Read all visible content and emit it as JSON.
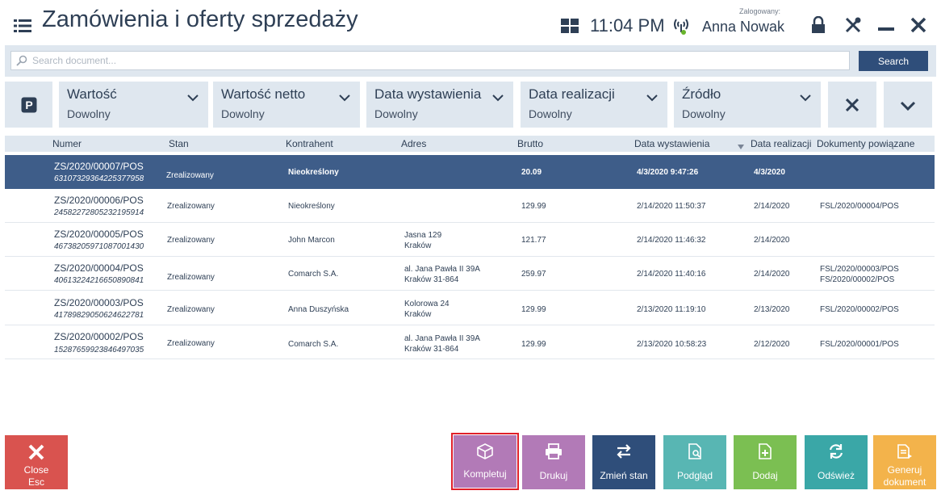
{
  "header": {
    "title": "Zamówienia i oferty sprzedaży",
    "time": "11:04 PM",
    "logged_label": "Zalogowany:",
    "user": "Anna Nowak"
  },
  "search": {
    "placeholder": "Search document...",
    "button": "Search"
  },
  "filters": [
    {
      "label": "Wartość",
      "value": "Dowolny"
    },
    {
      "label": "Wartość netto",
      "value": "Dowolny"
    },
    {
      "label": "Data wystawienia",
      "value": "Dowolny"
    },
    {
      "label": "Data realizacji",
      "value": "Dowolny"
    },
    {
      "label": "Źródło",
      "value": "Dowolny"
    }
  ],
  "table": {
    "columns": [
      "Numer",
      "Stan",
      "Kontrahent",
      "Adres",
      "Brutto",
      "Data wystawienia",
      "Data realizacji",
      "Dokumenty powiązane"
    ],
    "rows": [
      {
        "numer": "ZS/2020/00007/POS",
        "code": "63107329364225377958",
        "stan": "Zrealizowany",
        "kontrahent": "Nieokreślony",
        "adres1": "",
        "adres2": "",
        "brutto": "20.09",
        "data_wyst": "4/3/2020 9:47:26",
        "data_real": "4/3/2020",
        "dok1": "",
        "dok2": ""
      },
      {
        "numer": "ZS/2020/00006/POS",
        "code": "24582272805232195914",
        "stan": "Zrealizowany",
        "kontrahent": "Nieokreślony",
        "adres1": "",
        "adres2": "",
        "brutto": "129.99",
        "data_wyst": "2/14/2020 11:50:37",
        "data_real": "2/14/2020",
        "dok1": "FSL/2020/00004/POS",
        "dok2": ""
      },
      {
        "numer": "ZS/2020/00005/POS",
        "code": "46738205971087001430",
        "stan": "Zrealizowany",
        "kontrahent": "John Marcon",
        "adres1": "Jasna 129",
        "adres2": "Kraków",
        "brutto": "121.77",
        "data_wyst": "2/14/2020 11:46:32",
        "data_real": "2/14/2020",
        "dok1": "",
        "dok2": ""
      },
      {
        "numer": "ZS/2020/00004/POS",
        "code": "40613224216650890841",
        "stan": "Zrealizowany",
        "kontrahent": "Comarch S.A.",
        "adres1": "al. Jana Pawła II 39A",
        "adres2": "Kraków 31-864",
        "brutto": "259.97",
        "data_wyst": "2/14/2020 11:40:16",
        "data_real": "2/14/2020",
        "dok1": "FSL/2020/00003/POS",
        "dok2": "FS/2020/00002/POS"
      },
      {
        "numer": "ZS/2020/00003/POS",
        "code": "41789829050624622781",
        "stan": "Zrealizowany",
        "kontrahent": "Anna Duszyńska",
        "adres1": "Kolorowa 24",
        "adres2": "Kraków",
        "brutto": "129.99",
        "data_wyst": "2/13/2020 11:19:10",
        "data_real": "2/13/2020",
        "dok1": "FSL/2020/00002/POS",
        "dok2": ""
      },
      {
        "numer": "ZS/2020/00002/POS",
        "code": "15287659923846497035",
        "stan": "Zrealizowany",
        "kontrahent": "Comarch S.A.",
        "adres1": "al. Jana Pawła II 39A",
        "adres2": "Kraków 31-864",
        "brutto": "129.99",
        "data_wyst": "2/13/2020 10:58:23",
        "data_real": "2/12/2020",
        "dok1": "FSL/2020/00001/POS",
        "dok2": ""
      }
    ]
  },
  "buttons": {
    "close": "Close",
    "close_key": "Esc",
    "kompletuj": "Kompletuj",
    "drukuj": "Drukuj",
    "zmien": "Zmień stan",
    "podglad": "Podgląd",
    "dodaj": "Dodaj",
    "odswiez": "Odśwież",
    "generuj1": "Generuj",
    "generuj2": "dokument"
  },
  "colors": {
    "accent": "#3e5d89",
    "close": "#d9534f",
    "kompletuj": "#b27ab7",
    "drukuj": "#b27ab7",
    "zmien": "#2f4e7a",
    "podglad": "#58b6b3",
    "dodaj": "#7bbf52",
    "odswiez": "#3aa7a7",
    "generuj": "#f3b34b",
    "highlight": "#e0202a"
  },
  "icons": [
    "menu-icon",
    "grid-icon",
    "antenna-icon",
    "lock-icon",
    "tools-icon",
    "minimize-icon",
    "close-icon",
    "search-icon",
    "parking-icon",
    "chevron-down-icon",
    "clear-filter-icon",
    "expand-icon",
    "sort-arrow-icon",
    "box-icon",
    "printer-icon",
    "swap-icon",
    "preview-icon",
    "add-document-icon",
    "refresh-icon",
    "generate-document-icon"
  ]
}
